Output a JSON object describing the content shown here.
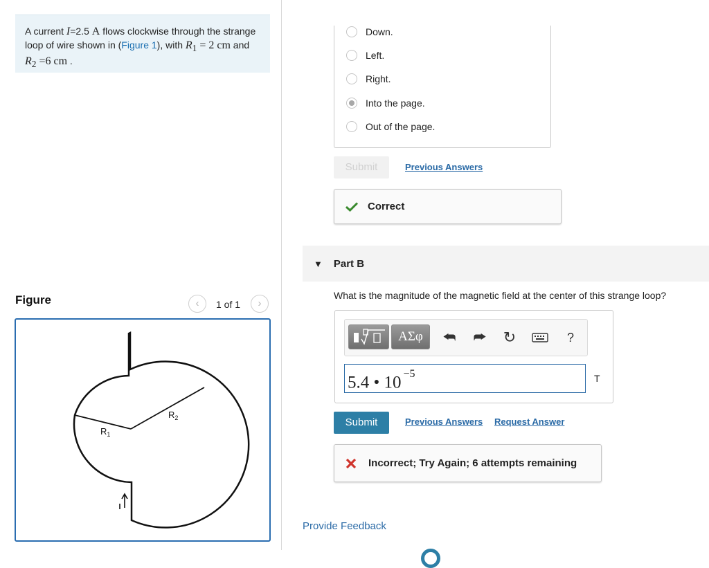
{
  "problem": {
    "text_before": "A current ",
    "current_symbol": "I",
    "current_value": "=2.5",
    "current_unit": "A",
    "text_mid": " flows clockwise through the strange loop of wire shown in (",
    "figure_link": "Figure 1",
    "text_after": "), with ",
    "r1_symbol": "R",
    "r1_sub": "1",
    "r1_value": " = 2 cm",
    "and_text": " and ",
    "r2_symbol": "R",
    "r2_sub": "2",
    "r2_value": " =6 cm",
    "end_text": " ."
  },
  "figure": {
    "heading": "Figure",
    "prev_icon": "chevron-left-icon",
    "next_icon": "chevron-right-icon",
    "page": "1 of 1",
    "label_r1": "R1",
    "label_r2": "R2"
  },
  "part_a": {
    "options": [
      {
        "label": "Down.",
        "selected": false
      },
      {
        "label": "Left.",
        "selected": false
      },
      {
        "label": "Right.",
        "selected": false
      },
      {
        "label": "Into the page.",
        "selected": true
      },
      {
        "label": "Out of the page.",
        "selected": false
      }
    ],
    "submit_label": "Submit",
    "previous_answers_label": "Previous Answers",
    "feedback": {
      "icon": "check-icon",
      "text": "Correct",
      "color": "#3a8a2e"
    }
  },
  "part_b": {
    "title": "Part B",
    "question": "What is the magnitude of the magnetic field at the center of this strange loop?",
    "toolbar": {
      "templates_icon": "math-templates-icon",
      "symbols_label": "ΑΣφ",
      "undo_icon": "undo-icon",
      "redo_icon": "redo-icon",
      "reset_icon": "reset-icon",
      "keyboard_icon": "keyboard-icon",
      "help_label": "?"
    },
    "answer_mantissa": "5.4 • 10",
    "answer_exponent": "−5",
    "unit": "T",
    "submit_label": "Submit",
    "previous_answers_label": "Previous Answers",
    "request_answer_label": "Request Answer",
    "feedback": {
      "icon": "x-icon",
      "text": "Incorrect; Try Again; 6 attempts remaining",
      "color": "#d0342c"
    }
  },
  "footer": {
    "provide_feedback": "Provide Feedback"
  }
}
